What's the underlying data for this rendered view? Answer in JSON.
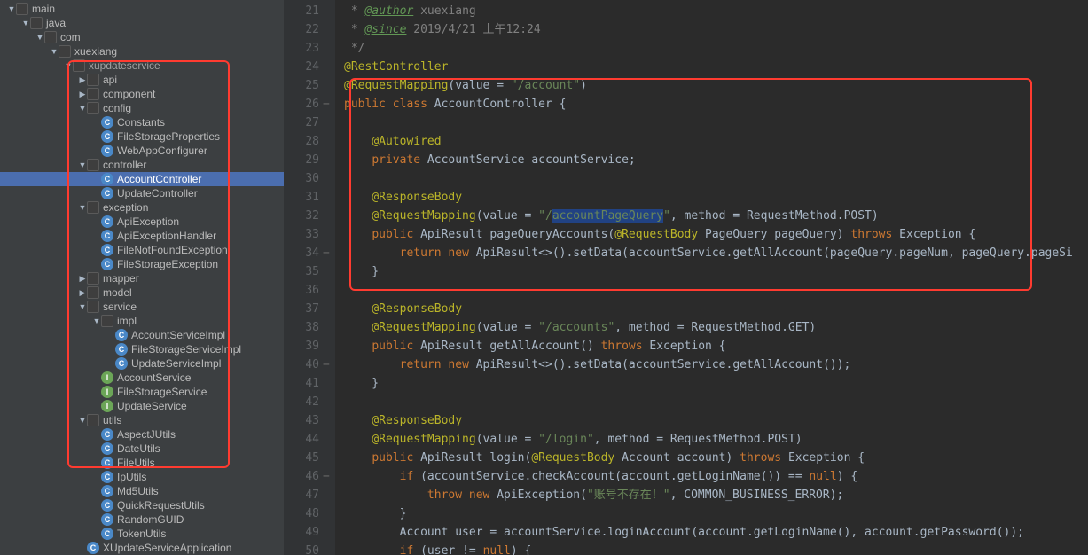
{
  "tree": [
    {
      "d": 0,
      "a": "down",
      "i": "folder",
      "t": "main"
    },
    {
      "d": 1,
      "a": "down",
      "i": "folder",
      "t": "java"
    },
    {
      "d": 2,
      "a": "down",
      "i": "folder",
      "t": "com"
    },
    {
      "d": 3,
      "a": "down",
      "i": "folder",
      "t": "xuexiang"
    },
    {
      "d": 4,
      "a": "down",
      "i": "folder",
      "t": "xupdateservice",
      "strike": true
    },
    {
      "d": 5,
      "a": "right",
      "i": "folder",
      "t": "api"
    },
    {
      "d": 5,
      "a": "right",
      "i": "folder",
      "t": "component"
    },
    {
      "d": 5,
      "a": "down",
      "i": "folder",
      "t": "config"
    },
    {
      "d": 6,
      "a": "",
      "i": "cls",
      "t": "Constants"
    },
    {
      "d": 6,
      "a": "",
      "i": "cls",
      "t": "FileStorageProperties"
    },
    {
      "d": 6,
      "a": "",
      "i": "cls",
      "t": "WebAppConfigurer"
    },
    {
      "d": 5,
      "a": "down",
      "i": "folder",
      "t": "controller"
    },
    {
      "d": 6,
      "a": "",
      "i": "cls",
      "t": "AccountController",
      "sel": true
    },
    {
      "d": 6,
      "a": "",
      "i": "cls",
      "t": "UpdateController"
    },
    {
      "d": 5,
      "a": "down",
      "i": "folder",
      "t": "exception"
    },
    {
      "d": 6,
      "a": "",
      "i": "cls",
      "t": "ApiException"
    },
    {
      "d": 6,
      "a": "",
      "i": "cls",
      "t": "ApiExceptionHandler"
    },
    {
      "d": 6,
      "a": "",
      "i": "cls",
      "t": "FileNotFoundException"
    },
    {
      "d": 6,
      "a": "",
      "i": "cls",
      "t": "FileStorageException"
    },
    {
      "d": 5,
      "a": "right",
      "i": "folder",
      "t": "mapper"
    },
    {
      "d": 5,
      "a": "right",
      "i": "folder",
      "t": "model"
    },
    {
      "d": 5,
      "a": "down",
      "i": "folder",
      "t": "service"
    },
    {
      "d": 6,
      "a": "down",
      "i": "folder",
      "t": "impl"
    },
    {
      "d": 7,
      "a": "",
      "i": "cls",
      "t": "AccountServiceImpl"
    },
    {
      "d": 7,
      "a": "",
      "i": "cls",
      "t": "FileStorageServiceImpl"
    },
    {
      "d": 7,
      "a": "",
      "i": "cls",
      "t": "UpdateServiceImpl"
    },
    {
      "d": 6,
      "a": "",
      "i": "iface",
      "t": "AccountService"
    },
    {
      "d": 6,
      "a": "",
      "i": "iface",
      "t": "FileStorageService"
    },
    {
      "d": 6,
      "a": "",
      "i": "iface",
      "t": "UpdateService"
    },
    {
      "d": 5,
      "a": "down",
      "i": "folder",
      "t": "utils"
    },
    {
      "d": 6,
      "a": "",
      "i": "cls",
      "t": "AspectJUtils"
    },
    {
      "d": 6,
      "a": "",
      "i": "cls",
      "t": "DateUtils"
    },
    {
      "d": 6,
      "a": "",
      "i": "cls",
      "t": "FileUtils"
    },
    {
      "d": 6,
      "a": "",
      "i": "cls",
      "t": "IpUtils"
    },
    {
      "d": 6,
      "a": "",
      "i": "cls",
      "t": "Md5Utils"
    },
    {
      "d": 6,
      "a": "",
      "i": "cls",
      "t": "QuickRequestUtils"
    },
    {
      "d": 6,
      "a": "",
      "i": "cls",
      "t": "RandomGUID"
    },
    {
      "d": 6,
      "a": "",
      "i": "cls",
      "t": "TokenUtils"
    },
    {
      "d": 5,
      "a": "",
      "i": "cls",
      "t": "XUpdateServiceApplication"
    }
  ],
  "code": {
    "start": 21,
    "marks": [
      26,
      34,
      40,
      46
    ],
    "lines": [
      [
        [
          "c-cmt",
          " * "
        ],
        [
          "c-doc",
          "@author"
        ],
        [
          "c-cmt",
          " xuexiang"
        ]
      ],
      [
        [
          "c-cmt",
          " * "
        ],
        [
          "c-doc",
          "@since"
        ],
        [
          "c-cmt",
          " 2019/4/21 上午12:24"
        ]
      ],
      [
        [
          "c-cmt",
          " */"
        ]
      ],
      [
        [
          "c-ann",
          "@RestController"
        ]
      ],
      [
        [
          "c-ann",
          "@RequestMapping"
        ],
        [
          "",
          "(value = "
        ],
        [
          "c-str",
          "\"/account\""
        ],
        [
          "",
          ")"
        ]
      ],
      [
        [
          "c-key",
          "public class "
        ],
        [
          "",
          "AccountController {"
        ]
      ],
      [
        [
          "",
          ""
        ]
      ],
      [
        [
          "",
          "    "
        ],
        [
          "c-ann",
          "@Autowired"
        ]
      ],
      [
        [
          "",
          "    "
        ],
        [
          "c-key",
          "private"
        ],
        [
          "",
          " AccountService accountService;"
        ]
      ],
      [
        [
          "",
          ""
        ]
      ],
      [
        [
          "",
          "    "
        ],
        [
          "c-ann",
          "@ResponseBody"
        ]
      ],
      [
        [
          "",
          "    "
        ],
        [
          "c-ann",
          "@RequestMapping"
        ],
        [
          "",
          "(value = "
        ],
        [
          "c-str",
          "\"/"
        ],
        [
          "c-str c-sel",
          "accountPageQuery"
        ],
        [
          "c-str",
          "\""
        ],
        [
          "",
          ", method = RequestMethod."
        ],
        [
          "",
          "POST)"
        ]
      ],
      [
        [
          "",
          "    "
        ],
        [
          "c-key",
          "public"
        ],
        [
          "",
          " ApiResult pageQueryAccounts("
        ],
        [
          "c-ann",
          "@RequestBody"
        ],
        [
          "",
          " PageQuery pageQuery) "
        ],
        [
          "c-key",
          "throws"
        ],
        [
          "",
          " Exception {"
        ]
      ],
      [
        [
          "",
          "        "
        ],
        [
          "c-key",
          "return new"
        ],
        [
          "",
          " ApiResult<>().setData(accountService.getAllAccount(pageQuery.pageNum, pageQuery.pageSi"
        ]
      ],
      [
        [
          "",
          "    }"
        ]
      ],
      [
        [
          "",
          ""
        ]
      ],
      [
        [
          "",
          "    "
        ],
        [
          "c-ann",
          "@ResponseBody"
        ]
      ],
      [
        [
          "",
          "    "
        ],
        [
          "c-ann",
          "@RequestMapping"
        ],
        [
          "",
          "(value = "
        ],
        [
          "c-str",
          "\"/accounts\""
        ],
        [
          "",
          ", method = RequestMethod."
        ],
        [
          "",
          "GET)"
        ]
      ],
      [
        [
          "",
          "    "
        ],
        [
          "c-key",
          "public"
        ],
        [
          "",
          " ApiResult getAllAccount() "
        ],
        [
          "c-key",
          "throws"
        ],
        [
          "",
          " Exception {"
        ]
      ],
      [
        [
          "",
          "        "
        ],
        [
          "c-key",
          "return new"
        ],
        [
          "",
          " ApiResult<>().setData(accountService.getAllAccount());"
        ]
      ],
      [
        [
          "",
          "    }"
        ]
      ],
      [
        [
          "",
          ""
        ]
      ],
      [
        [
          "",
          "    "
        ],
        [
          "c-ann",
          "@ResponseBody"
        ]
      ],
      [
        [
          "",
          "    "
        ],
        [
          "c-ann",
          "@RequestMapping"
        ],
        [
          "",
          "(value = "
        ],
        [
          "c-str",
          "\"/login\""
        ],
        [
          "",
          ", method = RequestMethod."
        ],
        [
          "",
          "POST)"
        ]
      ],
      [
        [
          "",
          "    "
        ],
        [
          "c-key",
          "public"
        ],
        [
          "",
          " ApiResult login("
        ],
        [
          "c-ann",
          "@RequestBody"
        ],
        [
          "",
          " Account account) "
        ],
        [
          "c-key",
          "throws"
        ],
        [
          "",
          " Exception {"
        ]
      ],
      [
        [
          "",
          "        "
        ],
        [
          "c-key",
          "if"
        ],
        [
          "",
          " (accountService.checkAccount(account.getLoginName()) == "
        ],
        [
          "c-key",
          "null"
        ],
        [
          "",
          ") {"
        ]
      ],
      [
        [
          "",
          "            "
        ],
        [
          "c-key",
          "throw new"
        ],
        [
          "",
          " ApiException("
        ],
        [
          "c-str",
          "\"账号不存在！\""
        ],
        [
          "",
          ", COMMON_BUSINESS_ERROR);"
        ]
      ],
      [
        [
          "",
          "        }"
        ]
      ],
      [
        [
          "",
          "        Account user = accountService.loginAccount(account.getLoginName(), account.getPassword());"
        ]
      ],
      [
        [
          "",
          "        "
        ],
        [
          "c-key",
          "if"
        ],
        [
          "",
          " (user != "
        ],
        [
          "c-key",
          "null"
        ],
        [
          "",
          ") {"
        ]
      ]
    ]
  }
}
